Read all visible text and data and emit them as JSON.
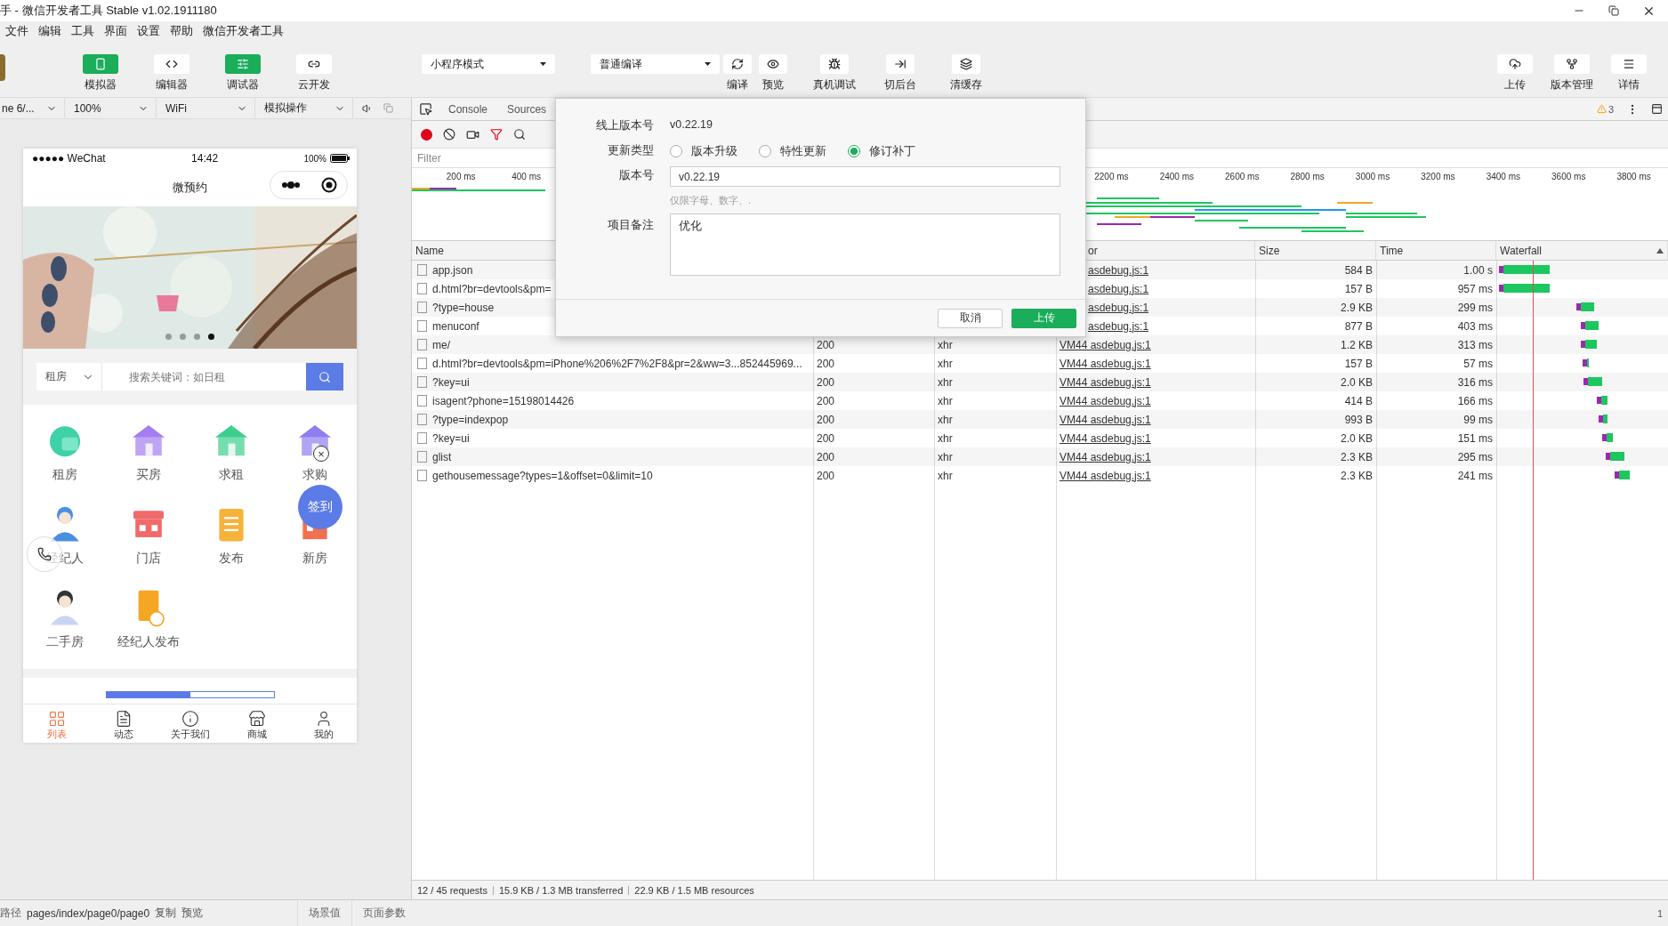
{
  "window": {
    "title": "手 - 微信开发者工具 Stable v1.02.1911180"
  },
  "menu": [
    "文件",
    "编辑",
    "工具",
    "界面",
    "设置",
    "帮助",
    "微信开发者工具"
  ],
  "toolbar": {
    "view_buttons": [
      {
        "label": "模拟器",
        "on": true
      },
      {
        "label": "编辑器",
        "on": false
      },
      {
        "label": "调试器",
        "on": true
      },
      {
        "label": "云开发",
        "on": false
      }
    ],
    "mode_select": "小程序模式",
    "compile_select": "普通编译",
    "actions": [
      "编译",
      "预览",
      "真机调试",
      "切后台",
      "清缓存"
    ],
    "right_actions": [
      "上传",
      "版本管理",
      "详情"
    ]
  },
  "simulator_bar": {
    "device": "ne 6/...",
    "zoom": "100%",
    "network": "WiFi",
    "operation": "模拟操作"
  },
  "phone": {
    "status": {
      "carrier": "●●●●● WeChat",
      "time": "14:42",
      "battery": "100%"
    },
    "nav_title": "微预约",
    "banner": {
      "dots": [
        {
          "selected": false
        },
        {
          "selected": false
        },
        {
          "selected": false
        },
        {
          "selected": true
        }
      ]
    },
    "search": {
      "category": "租房",
      "placeholder": "搜索关键词：如日租"
    },
    "grid": [
      "租房",
      "买房",
      "求租",
      "求购",
      "经纪人",
      "门店",
      "发布",
      "新房",
      "二手房",
      "经纪人发布"
    ],
    "sign_button": "签到",
    "close_mark": "×",
    "tabs": [
      {
        "label": "列表",
        "selected": true
      },
      {
        "label": "动态",
        "selected": false
      },
      {
        "label": "关于我们",
        "selected": false
      },
      {
        "label": "商城",
        "selected": false
      },
      {
        "label": "我的",
        "selected": false
      }
    ]
  },
  "devtools": {
    "tabs": [
      "Console",
      "Sources"
    ],
    "warnings": "3",
    "filter_placeholder": "Filter",
    "overview": {
      "ticks_left": [
        "200 ms",
        "400 ms"
      ],
      "ticks_right": [
        "2200 ms",
        "2400 ms",
        "2600 ms",
        "2800 ms",
        "3000 ms",
        "3200 ms",
        "3400 ms",
        "3600 ms",
        "3800 ms"
      ]
    },
    "columns": {
      "name": "Name",
      "initiator": "or",
      "size": "Size",
      "time": "Time",
      "waterfall": "Waterfall"
    },
    "rows": [
      {
        "name": "app.json",
        "initiator": "asdebug.js:1",
        "size": "584 B",
        "time": "1.00 s"
      },
      {
        "name": "d.html?br=devtools&pm=",
        "initiator": "asdebug.js:1",
        "size": "157 B",
        "time": "957 ms"
      },
      {
        "name": "?type=house",
        "initiator": "asdebug.js:1",
        "size": "2.9 KB",
        "time": "299 ms"
      },
      {
        "name": "menuconf",
        "initiator": "asdebug.js:1",
        "size": "877 B",
        "time": "403 ms"
      },
      {
        "name": "me/",
        "status": "200",
        "type": "xhr",
        "initiator": "VM44 asdebug.js:1",
        "size": "1.2 KB",
        "time": "313 ms"
      },
      {
        "name": "d.html?br=devtools&pm=iPhone%206%2F7%2F8&pr=2&ww=3...852445969...",
        "status": "200",
        "type": "xhr",
        "initiator": "VM44 asdebug.js:1",
        "size": "157 B",
        "time": "57 ms"
      },
      {
        "name": "?key=ui",
        "status": "200",
        "type": "xhr",
        "initiator": "VM44 asdebug.js:1",
        "size": "2.0 KB",
        "time": "316 ms"
      },
      {
        "name": "isagent?phone=15198014426",
        "status": "200",
        "type": "xhr",
        "initiator": "VM44 asdebug.js:1",
        "size": "414 B",
        "time": "166 ms"
      },
      {
        "name": "?type=indexpop",
        "status": "200",
        "type": "xhr",
        "initiator": "VM44 asdebug.js:1",
        "size": "993 B",
        "time": "99 ms"
      },
      {
        "name": "?key=ui",
        "status": "200",
        "type": "xhr",
        "initiator": "VM44 asdebug.js:1",
        "size": "2.0 KB",
        "time": "151 ms"
      },
      {
        "name": "glist",
        "status": "200",
        "type": "xhr",
        "initiator": "VM44 asdebug.js:1",
        "size": "2.3 KB",
        "time": "295 ms"
      },
      {
        "name": "gethousemessage?types=1&offset=0&limit=10",
        "status": "200",
        "type": "xhr",
        "initiator": "VM44 asdebug.js:1",
        "size": "2.3 KB",
        "time": "241 ms"
      }
    ],
    "summary": [
      "12 / 45 requests",
      "15.9 KB / 1.3 MB transferred",
      "22.9 KB / 1.5 MB resources"
    ]
  },
  "upload_dialog": {
    "online_version_label": "线上版本号",
    "online_version": "v0.22.19",
    "update_type_label": "更新类型",
    "update_types": [
      {
        "label": "版本升级",
        "selected": false
      },
      {
        "label": "特性更新",
        "selected": false
      },
      {
        "label": "修订补丁",
        "selected": true
      }
    ],
    "version_label": "版本号",
    "version": "v0.22.19",
    "version_hint": "仅限字母、数字、.",
    "notes_label": "项目备注",
    "notes": "优化",
    "cancel": "取消",
    "upload": "上传"
  },
  "status_bar": {
    "path_label": "路径",
    "path": "pages/index/page0/page0",
    "copy": "复制",
    "preview": "预览",
    "scene": "场景值",
    "params": "页面参数",
    "notifications": "1"
  }
}
